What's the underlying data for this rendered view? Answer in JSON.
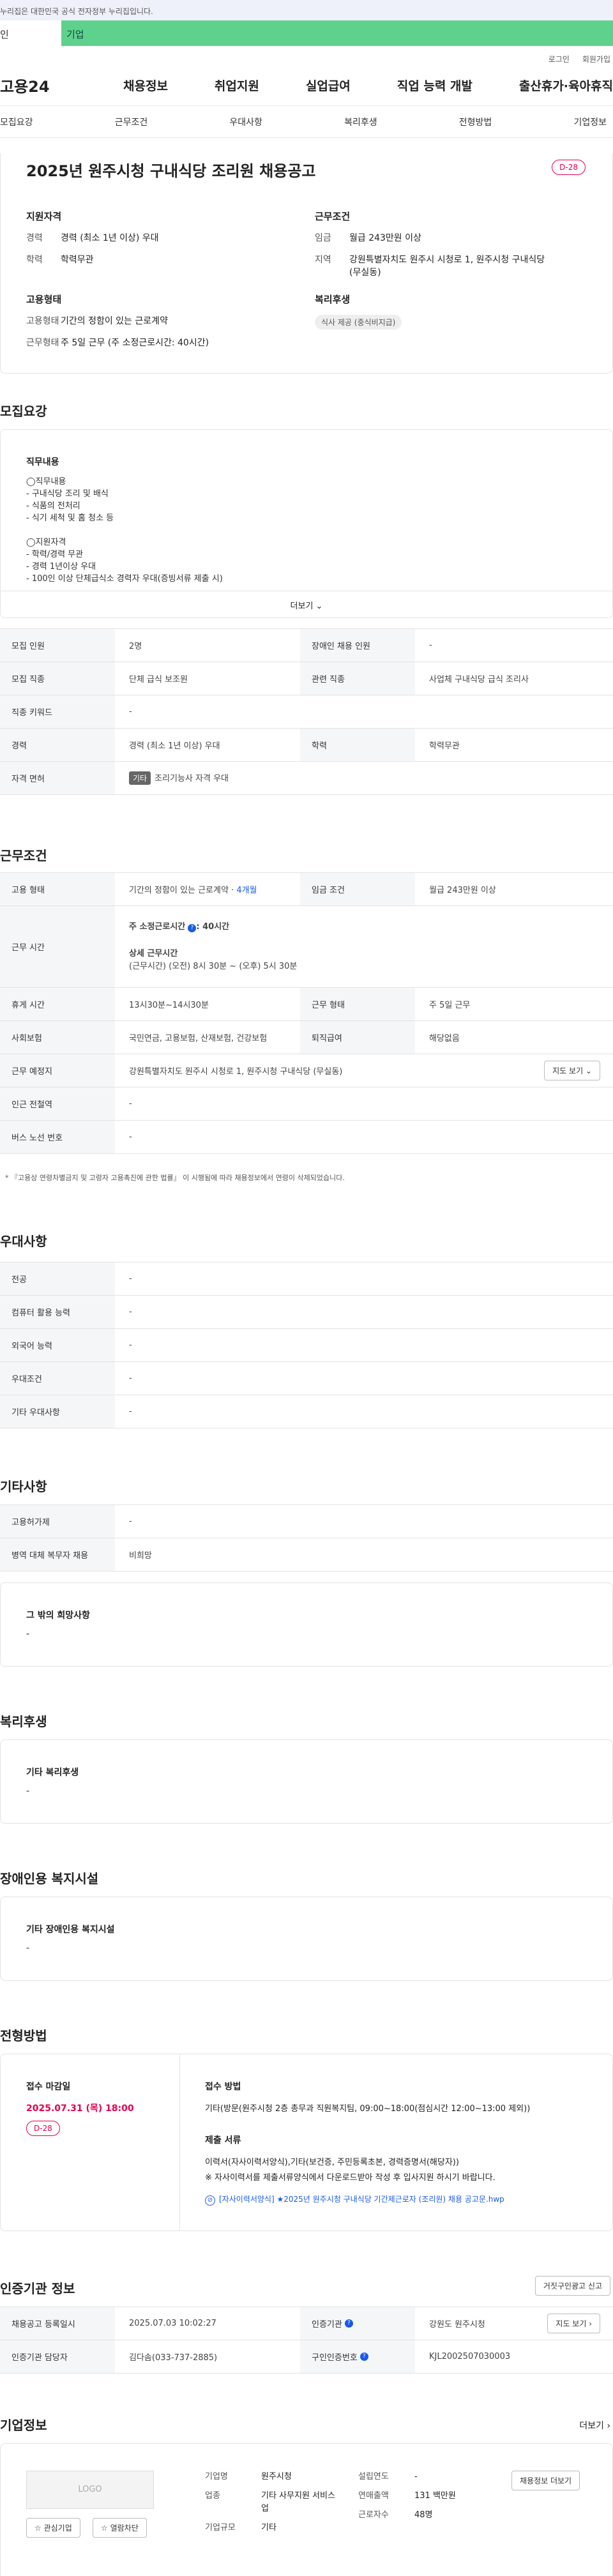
{
  "gov_banner": "누리집은 대한민국 공식 전자정부 누리집입니다.",
  "site_tabs": [
    "인",
    "기업"
  ],
  "util": [
    "로그인",
    "회원가입"
  ],
  "gnb": {
    "logo": "고용24",
    "menus": [
      "채용정보",
      "취업지원",
      "실업급여",
      "직업 능력 개발",
      "출산휴가·육아휴직"
    ]
  },
  "anchor_tabs": [
    "모집요강",
    "근무조건",
    "우대사항",
    "복리후생",
    "전형방법",
    "기업정보"
  ],
  "summary": {
    "title": "2025년 원주시청 구내식당 조리원 채용공고",
    "dday": "D-28",
    "qual_h": "지원자격",
    "exp_k": "경력",
    "exp_v": "경력 (최소 1년 이상) 우대",
    "edu_k": "학력",
    "edu_v": "학력무관",
    "cond_h": "근무조건",
    "wage_k": "임금",
    "wage_v": "월급 243만원 이상",
    "area_k": "지역",
    "area_v": "강원특별자치도 원주시 시청로 1, 원주시청 구내식당 (무실동)",
    "emp_h": "고용형태",
    "emptype_k": "고용형태",
    "emptype_v": "기간의 정함이 있는 근로계약",
    "work_k": "근무형태",
    "work_v": "주 5일 근무 (주 소정근로시간: 40시간)",
    "welfare_h": "복리후생",
    "welfare_badge": "식사 제공 (중식비지급)"
  },
  "recruit": {
    "h": "모집요강",
    "job_h": "직무내용",
    "lines": [
      "◯직무내용",
      "- 구내식당 조리 및 배식",
      "- 식품의 전처리",
      "- 식기 세척 및 홈 청소 등",
      "",
      "◯지원자격",
      "- 학력/경력 무관",
      "- 경력 1년이상 우대",
      "- 100인 이상 단체급식소 경력자 우대(증빙서류 제출 시)"
    ],
    "more": "더보기 ⌄",
    "rows": [
      [
        "모집 인원",
        "2명",
        "장애인 채용 인원",
        "-"
      ],
      [
        "모집 직종",
        "단체 급식 보조원",
        "관련 직종",
        "사업체 구내식당 급식 조리사"
      ],
      [
        "직종 키워드",
        "-",
        "",
        ""
      ],
      [
        "경력",
        "경력 (최소 1년 이상) 우대",
        "학력",
        "학력무관"
      ],
      [
        "자격 면허",
        "조리기능사 자격 우대",
        "",
        ""
      ]
    ],
    "cert_tag": "기타"
  },
  "cond": {
    "h": "근무조건",
    "emp_k": "고용 형태",
    "emp_v": "기간의 정함이 있는 근로계약 · ",
    "emp_link": "4개월",
    "wage_k": "임금 조건",
    "wage_v": "월급 243만원 이상",
    "time_k": "근무 시간",
    "time1": "주 소정근로시간",
    "time1v": ": 40시간",
    "time2": "상세 근무시간",
    "time3": "(근무시간) (오전) 8시 30분 ~ (오후) 5시 30분",
    "rest_k": "휴게 시간",
    "rest_v": "13시30분~14시30분",
    "form_k": "근무 형태",
    "form_v": "주 5일 근무",
    "ins_k": "사회보험",
    "ins_v": "국민연금, 고용보험, 산재보험, 건강보험",
    "sev_k": "퇴직급여",
    "sev_v": "해당없음",
    "place_k": "근무 예정지",
    "place_v": "강원특별자치도 원주시 시청로 1, 원주시청 구내식당 (무실동)",
    "map": "지도 보기 ⌄",
    "sub_k": "인근 전철역",
    "sub_v": "-",
    "bus_k": "버스 노선 번호",
    "bus_v": "-",
    "note": "* 『고용상 연령차별금지 및 고령자 고용촉진에 관한 법률』 이 시행됨에 따라 채용정보에서 연령이 삭제되었습니다."
  },
  "pref": {
    "h": "우대사항",
    "rows": [
      [
        "전공",
        "-"
      ],
      [
        "컴퓨터 활용 능력",
        "-"
      ],
      [
        "외국어 능력",
        "-"
      ],
      [
        "우대조건",
        "-"
      ],
      [
        "기타 우대사항",
        "-"
      ]
    ]
  },
  "etc": {
    "h": "기타사항",
    "rows": [
      [
        "고용허가제",
        "-"
      ],
      [
        "병역 대체 복무자 채용",
        "비희망"
      ]
    ],
    "box_h": "그 밖의 희망사항",
    "box_v": "-"
  },
  "welfare": {
    "h": "복리후생",
    "box_h": "기타 복리후생",
    "box_v": "-"
  },
  "disab": {
    "h": "장애인용 복지시설",
    "box_h": "기타 장애인용 복지시설",
    "box_v": "-"
  },
  "proc": {
    "h": "전형방법",
    "deadline_h": "접수 마감일",
    "deadline": "2025.07.31 (목) 18:00",
    "dday": "D-28",
    "method_h": "접수 방법",
    "method_v": "기타(방문(원주시청 2층 총무과 직원복지팀, 09:00~18:00(점심시간 12:00~13:00 제외))",
    "docs_h": "제출 서류",
    "docs1": "이력서(자사이력서양식),기타(보건증, 주민등록초본, 경력증명서(해당자))",
    "docs2": "※ 자사이력서를 제출서류양식에서 다운로드받아 작성 후 입사지원 하시기 바랍니다.",
    "file": "[자사이력서양식] ★2025년 원주시청 구내식당 기간제근로자 (조리원) 채용 공고문.hwp"
  },
  "agency": {
    "h": "인증기관 정보",
    "report": "거짓구인광고 신고",
    "reg_k": "채용공고 등록일시",
    "reg_v": "2025.07.03 10:02:27",
    "org_k": "인증기관",
    "org_v": "강원도 원주시청",
    "map": "지도 보기 ›",
    "mgr_k": "인증기관 담당자",
    "mgr_v": "김다솜(033-737-2885)",
    "no_k": "구인인증번호",
    "no_v": "KJL2002507030003"
  },
  "company": {
    "h": "기업정보",
    "more": "더보기 ›",
    "logo": "LOGO",
    "fav": "☆ 관심기업",
    "block": "☆ 열람차단",
    "name_k": "기업명",
    "name_v": "원주시청",
    "ind_k": "업종",
    "ind_v": "기타 사무지원 서비스업",
    "size_k": "기업규모",
    "size_v": "기타",
    "est_k": "설립연도",
    "est_v": "-",
    "sales_k": "연매출액",
    "sales_v": "131 백만원",
    "emp_k": "근로자수",
    "emp_v": "48명",
    "recruit_btn": "채용정보 더보기"
  }
}
